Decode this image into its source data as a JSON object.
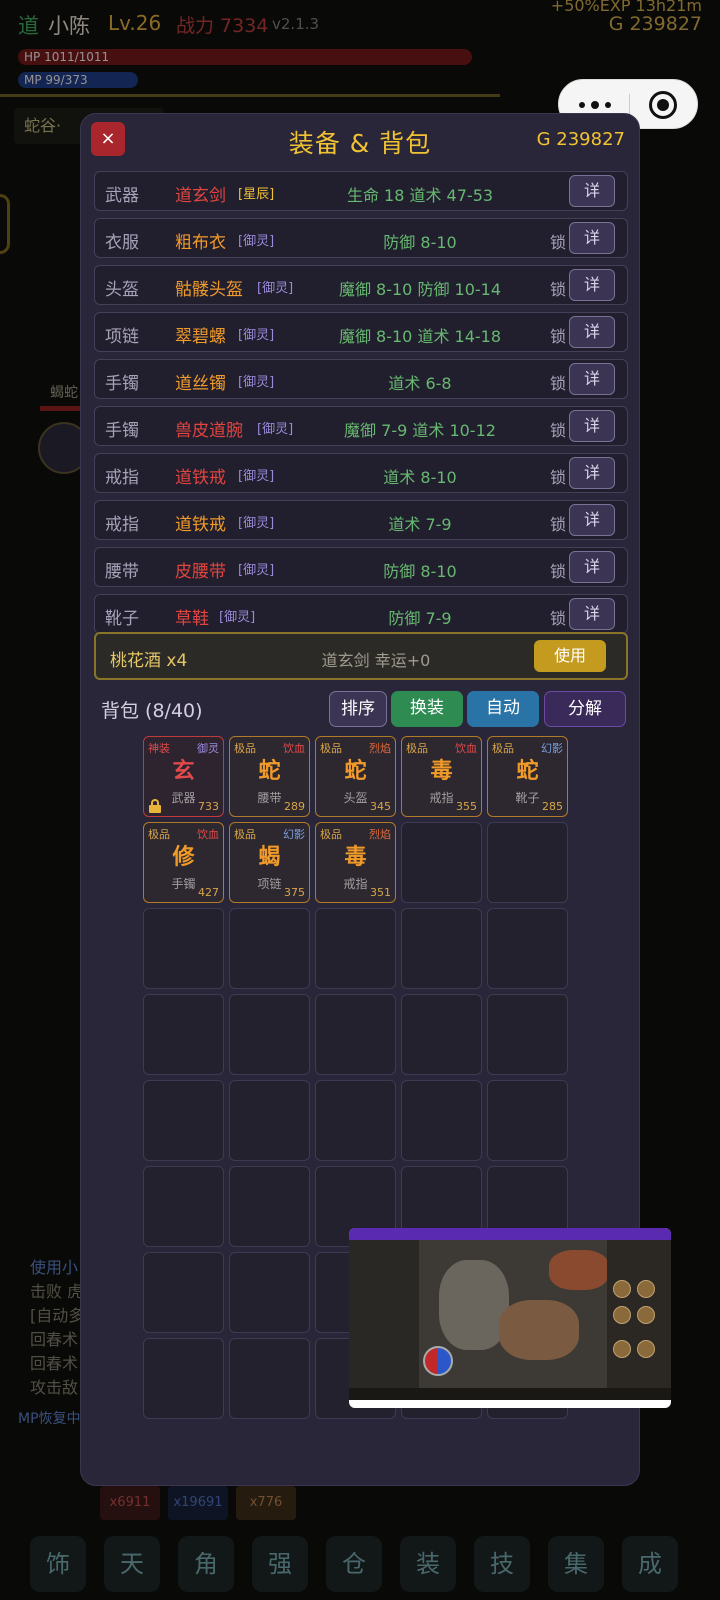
{
  "header": {
    "class": "道",
    "name": "小陈",
    "level": "Lv.26",
    "power": "战力 7334",
    "version": "v2.1.3",
    "exp_bonus": "+50%EXP 13h21m",
    "gold": "G 239827",
    "hp": "HP 1011/1011",
    "mp": "MP 99/373"
  },
  "background": {
    "location": "蛇谷·",
    "monster_name": "蝎蛇",
    "log": [
      "使用小",
      "击败 虎",
      "[自动多",
      "回春术",
      "回春术",
      "攻击敌"
    ],
    "log_last": "MP恢复中",
    "resources": [
      "x6911",
      "x19691",
      "x776"
    ],
    "nav": [
      "饰",
      "天",
      "角",
      "强",
      "仓",
      "装",
      "技",
      "集",
      "成"
    ]
  },
  "panel": {
    "close_label": "×",
    "title": "装备 & 背包",
    "gold": "G 239827",
    "lock_label": "锁",
    "detail_label": "详",
    "equipment": [
      {
        "slot": "武器",
        "name": "道玄剑",
        "tag": "[星辰]",
        "stats": "生命 18 道术 47-53",
        "locked": ""
      },
      {
        "slot": "衣服",
        "name": "粗布衣",
        "tag": "[御灵]",
        "stats": "防御 8-10",
        "locked": "锁"
      },
      {
        "slot": "头盔",
        "name": "骷髅头盔",
        "tag": "[御灵]",
        "stats": "魔御 8-10 防御 10-14",
        "locked": "锁"
      },
      {
        "slot": "项链",
        "name": "翠碧螺",
        "tag": "[御灵]",
        "stats": "魔御 8-10 道术 14-18",
        "locked": "锁"
      },
      {
        "slot": "手镯",
        "name": "道丝镯",
        "tag": "[御灵]",
        "stats": "道术 6-8",
        "locked": "锁"
      },
      {
        "slot": "手镯",
        "name": "兽皮道腕",
        "tag": "[御灵]",
        "stats": "魔御 7-9 道术 10-12",
        "locked": "锁"
      },
      {
        "slot": "戒指",
        "name": "道铁戒",
        "tag": "[御灵]",
        "stats": "道术 8-10",
        "locked": "锁"
      },
      {
        "slot": "戒指",
        "name": "道铁戒",
        "tag": "[御灵]",
        "stats": "道术 7-9",
        "locked": "锁"
      },
      {
        "slot": "腰带",
        "name": "皮腰带",
        "tag": "[御灵]",
        "stats": "防御 8-10",
        "locked": "锁"
      },
      {
        "slot": "靴子",
        "name": "草鞋",
        "tag": "[御灵]",
        "stats": "防御 7-9",
        "locked": "锁"
      }
    ],
    "potion": {
      "name": "桃花酒 x4",
      "info": "道玄剑 幸运+0",
      "use_label": "使用"
    },
    "bag": {
      "title": "背包 (8/40)",
      "buttons": [
        "排序",
        "换装",
        "自动",
        "分解"
      ],
      "items": [
        {
          "grade": "神装",
          "affix": "御灵",
          "char": "玄",
          "slot": "武器",
          "num": "733"
        },
        {
          "grade": "极品",
          "affix": "饮血",
          "char": "蛇",
          "slot": "腰带",
          "num": "289"
        },
        {
          "grade": "极品",
          "affix": "烈焰",
          "char": "蛇",
          "slot": "头盔",
          "num": "345"
        },
        {
          "grade": "极品",
          "affix": "饮血",
          "char": "毒",
          "slot": "戒指",
          "num": "355"
        },
        {
          "grade": "极品",
          "affix": "幻影",
          "char": "蛇",
          "slot": "靴子",
          "num": "285"
        },
        {
          "grade": "极品",
          "affix": "饮血",
          "char": "修",
          "slot": "手镯",
          "num": "427"
        },
        {
          "grade": "极品",
          "affix": "幻影",
          "char": "蝎",
          "slot": "项链",
          "num": "375"
        },
        {
          "grade": "极品",
          "affix": "烈焰",
          "char": "毒",
          "slot": "戒指",
          "num": "351"
        }
      ]
    }
  },
  "colors": {
    "panel_bg": "#2a2639",
    "accent_gold": "#f1c232",
    "red_item": "#e0453f",
    "orange_item": "#f09a2a",
    "stat_green": "#67b870",
    "tag_purple": "#9a8ad8",
    "btn_sort": "#3b3452",
    "btn_swap": "#2e8c52",
    "btn_auto": "#2a73a6",
    "btn_decompose": "#3a2a5a"
  },
  "icons": {
    "close": "close-icon",
    "lock": "lock-icon",
    "more": "more-dots-icon",
    "exit": "exit-circle-icon"
  }
}
